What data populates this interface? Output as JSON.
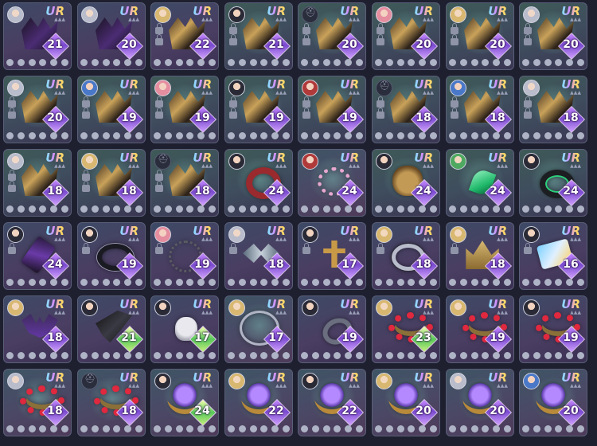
{
  "colors": {
    "background": "#1e2030",
    "card": "#3a3e55",
    "level_badge": "#8a52d8",
    "level_badge_green": "#58c85a"
  },
  "items": [
    {
      "rarity": "UR",
      "level": "21",
      "avatar": "silver",
      "item": "helm-dark-icon",
      "bg": "purple"
    },
    {
      "rarity": "UR",
      "level": "20",
      "avatar": "silver",
      "item": "helm-dark-icon",
      "bg": "purple"
    },
    {
      "rarity": "UR",
      "level": "22",
      "avatar": "gold",
      "item": "helm-gold-icon",
      "bg": "purple",
      "locks": 2
    },
    {
      "rarity": "UR",
      "level": "21",
      "avatar": "dark",
      "item": "helm-gold-icon",
      "bg": "green",
      "locks": 2
    },
    {
      "rarity": "UR",
      "level": "20",
      "avatar": "helm",
      "item": "helm-gold-icon",
      "bg": "green",
      "locks": 2
    },
    {
      "rarity": "UR",
      "level": "20",
      "avatar": "pink",
      "item": "helm-gold-icon",
      "bg": "green",
      "locks": 2
    },
    {
      "rarity": "UR",
      "level": "20",
      "avatar": "gold",
      "item": "helm-gold-icon",
      "bg": "green",
      "locks": 2
    },
    {
      "rarity": "UR",
      "level": "20",
      "avatar": "silver",
      "item": "helm-gold-icon",
      "bg": "green",
      "locks": 2
    },
    {
      "rarity": "UR",
      "level": "20",
      "avatar": "silver",
      "item": "helm-gold-icon",
      "bg": "green",
      "locks": 2
    },
    {
      "rarity": "UR",
      "level": "19",
      "avatar": "blue",
      "item": "helm-gold-icon",
      "bg": "green",
      "locks": 2
    },
    {
      "rarity": "UR",
      "level": "19",
      "avatar": "pink",
      "item": "helm-gold-icon",
      "bg": "green",
      "locks": 2
    },
    {
      "rarity": "UR",
      "level": "19",
      "avatar": "dark",
      "item": "helm-gold-icon",
      "bg": "green",
      "locks": 2
    },
    {
      "rarity": "UR",
      "level": "19",
      "avatar": "red",
      "item": "helm-gold-icon",
      "bg": "green",
      "locks": 2
    },
    {
      "rarity": "UR",
      "level": "18",
      "avatar": "helm",
      "item": "helm-gold-icon",
      "bg": "green",
      "locks": 2
    },
    {
      "rarity": "UR",
      "level": "18",
      "avatar": "blue",
      "item": "helm-gold-icon",
      "bg": "green",
      "locks": 2
    },
    {
      "rarity": "UR",
      "level": "18",
      "avatar": "silver",
      "item": "helm-gold-icon",
      "bg": "green",
      "locks": 2
    },
    {
      "rarity": "UR",
      "level": "18",
      "avatar": "silver",
      "item": "helm-gold-icon",
      "bg": "green",
      "locks": 2
    },
    {
      "rarity": "UR",
      "level": "18",
      "avatar": "gold",
      "item": "helm-gold-icon",
      "bg": "green",
      "locks": 2
    },
    {
      "rarity": "UR",
      "level": "18",
      "avatar": "helm",
      "item": "helm-gold-icon",
      "bg": "green",
      "locks": 2
    },
    {
      "rarity": "UR",
      "level": "24",
      "avatar": "dark",
      "item": "ring-red-icon",
      "bg": "green"
    },
    {
      "rarity": "UR",
      "level": "24",
      "avatar": "red",
      "item": "bracelet-icon",
      "bg": "rain"
    },
    {
      "rarity": "UR",
      "level": "24",
      "avatar": "dark",
      "item": "bear-charm-icon",
      "bg": "green"
    },
    {
      "rarity": "UR",
      "level": "24",
      "avatar": "green",
      "item": "leaf-pendant-icon",
      "bg": "green"
    },
    {
      "rarity": "UR",
      "level": "24",
      "avatar": "dark",
      "item": "cuff-icon",
      "bg": "green"
    },
    {
      "rarity": "UR",
      "level": "24",
      "avatar": "dark",
      "item": "talisman-icon",
      "bg": "purple",
      "locks": 1
    },
    {
      "rarity": "UR",
      "level": "19",
      "avatar": "dark",
      "item": "choker-icon",
      "bg": "purple",
      "locks": 1
    },
    {
      "rarity": "UR",
      "level": "19",
      "avatar": "pink",
      "item": "rosary-icon",
      "bg": "purple",
      "locks": 1
    },
    {
      "rarity": "UR",
      "level": "18",
      "avatar": "silver",
      "item": "wings-icon",
      "bg": "purple",
      "locks": 1
    },
    {
      "rarity": "UR",
      "level": "17",
      "avatar": "dark",
      "item": "cross-necklace-icon",
      "bg": "purple",
      "locks": 1
    },
    {
      "rarity": "UR",
      "level": "18",
      "avatar": "gold",
      "item": "silver-ring-icon",
      "bg": "purple",
      "locks": 1
    },
    {
      "rarity": "UR",
      "level": "18",
      "avatar": "gold",
      "item": "crown-icon",
      "bg": "purple",
      "locks": 1
    },
    {
      "rarity": "UR",
      "level": "16",
      "avatar": "dark",
      "item": "scroll-icon",
      "bg": "purple",
      "locks": 1
    },
    {
      "rarity": "UR",
      "level": "18",
      "avatar": "gold",
      "item": "bat-wing-icon",
      "bg": "purple"
    },
    {
      "rarity": "UR",
      "level": "21",
      "avatar": "dark",
      "item": "dagger-icon",
      "bg": "purple",
      "green": true
    },
    {
      "rarity": "UR",
      "level": "17",
      "avatar": "dark",
      "item": "skull-icon",
      "bg": "purple",
      "green": true
    },
    {
      "rarity": "UR",
      "level": "17",
      "avatar": "gold",
      "item": "hoop-icon",
      "bg": "rain"
    },
    {
      "rarity": "UR",
      "level": "19",
      "avatar": "dark",
      "item": "dark-ring-icon",
      "bg": "purple"
    },
    {
      "rarity": "UR",
      "level": "23",
      "avatar": "gold",
      "item": "ruby-ring-icon",
      "bg": "purple",
      "green": true
    },
    {
      "rarity": "UR",
      "level": "19",
      "avatar": "gold",
      "item": "ruby-ring-icon",
      "bg": "purple"
    },
    {
      "rarity": "UR",
      "level": "19",
      "avatar": "dark",
      "item": "ruby-ring-icon",
      "bg": "purple"
    },
    {
      "rarity": "UR",
      "level": "18",
      "avatar": "silver",
      "item": "ruby-ring-icon",
      "bg": "rain"
    },
    {
      "rarity": "UR",
      "level": "18",
      "avatar": "helm",
      "item": "ruby-ring-icon",
      "bg": "rain"
    },
    {
      "rarity": "UR",
      "level": "24",
      "avatar": "dark",
      "item": "gem-ring-icon",
      "bg": "rain",
      "green": true
    },
    {
      "rarity": "UR",
      "level": "22",
      "avatar": "gold",
      "item": "gem-ring-icon",
      "bg": "rain"
    },
    {
      "rarity": "UR",
      "level": "22",
      "avatar": "dark",
      "item": "gem-ring-icon",
      "bg": "rain"
    },
    {
      "rarity": "UR",
      "level": "20",
      "avatar": "gold",
      "item": "gem-ring-icon",
      "bg": "rain"
    },
    {
      "rarity": "UR",
      "level": "20",
      "avatar": "silver",
      "item": "gem-ring-icon",
      "bg": "rain"
    },
    {
      "rarity": "UR",
      "level": "20",
      "avatar": "blue",
      "item": "gem-ring-icon",
      "bg": "rain"
    }
  ]
}
